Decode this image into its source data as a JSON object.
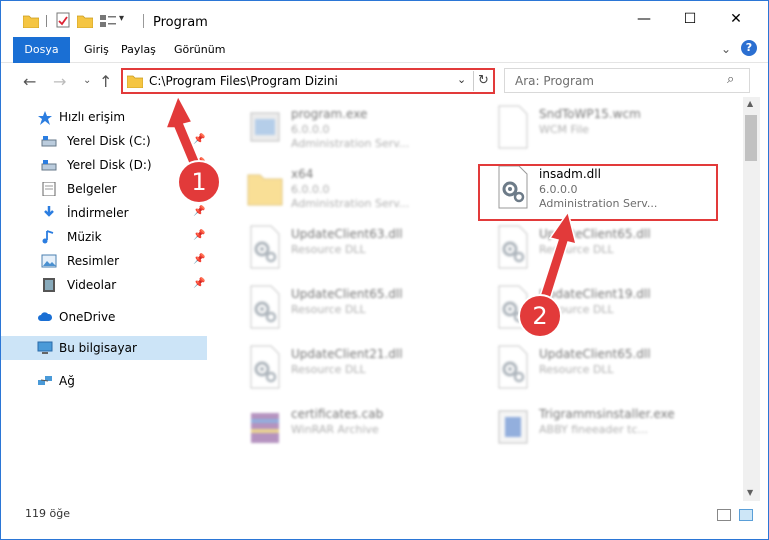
{
  "window": {
    "title": "Program",
    "controls": {
      "minimize": "—",
      "maximize": "☐",
      "close": "✕"
    }
  },
  "ribbon": {
    "tabs": [
      "Dosya",
      "Giriş",
      "Paylaş",
      "Görünüm"
    ],
    "expand": "⌄",
    "help": "?"
  },
  "nav": {
    "address": "C:\\Program Files\\Program Dizini",
    "search_placeholder": "Ara: Program",
    "back": "←",
    "forward": "→",
    "recent": "⌄",
    "up": "↑",
    "address_dropdown": "⌄",
    "refresh": "↻",
    "search_icon": "⌕"
  },
  "sidebar": {
    "items": [
      {
        "label": "Hızlı erişim",
        "icon": "star-icon",
        "pinned": false
      },
      {
        "label": "Yerel Disk (C:)",
        "icon": "drive-icon",
        "pinned": true
      },
      {
        "label": "Yerel Disk (D:)",
        "icon": "drive-icon",
        "pinned": true
      },
      {
        "label": "Belgeler",
        "icon": "document-icon",
        "pinned": true
      },
      {
        "label": "İndirmeler",
        "icon": "download-icon",
        "pinned": true
      },
      {
        "label": "Müzik",
        "icon": "music-icon",
        "pinned": true
      },
      {
        "label": "Resimler",
        "icon": "picture-icon",
        "pinned": true
      },
      {
        "label": "Videolar",
        "icon": "video-icon",
        "pinned": true
      },
      {
        "label": "OneDrive",
        "icon": "cloud-icon",
        "pinned": false
      },
      {
        "label": "Bu bilgisayar",
        "icon": "computer-icon",
        "pinned": false,
        "selected": true
      },
      {
        "label": "Ağ",
        "icon": "network-icon",
        "pinned": false
      }
    ],
    "pin_glyph": "📌"
  },
  "files": [
    {
      "name": "program.exe",
      "sub1": "6.0.0.0",
      "sub2": "Administration Serv...",
      "icon": "exe-icon",
      "blurred": true
    },
    {
      "name": "SndToWP15.wcm",
      "sub1": "WCM File",
      "sub2": "",
      "icon": "blank-file-icon",
      "blurred": true
    },
    {
      "name": "x64",
      "sub1": "6.0.0.0",
      "sub2": "Administration Serv...",
      "icon": "folder-icon",
      "blurred": true
    },
    {
      "name": "insadm.dll",
      "sub1": "6.0.0.0",
      "sub2": "Administration Serv...",
      "icon": "dll-gear-icon",
      "blurred": false
    },
    {
      "name": "UpdateClient63.dll",
      "sub1": "Resource DLL",
      "sub2": "",
      "icon": "dll-gear-icon",
      "blurred": true
    },
    {
      "name": "UpdateClient65.dll",
      "sub1": "Resource DLL",
      "sub2": "",
      "icon": "dll-gear-icon",
      "blurred": true
    },
    {
      "name": "UpdateClient65.dll",
      "sub1": "Resource DLL",
      "sub2": "",
      "icon": "dll-gear-icon",
      "blurred": true
    },
    {
      "name": "UpdateClient19.dll",
      "sub1": "Resource DLL",
      "sub2": "",
      "icon": "dll-gear-icon",
      "blurred": true
    },
    {
      "name": "UpdateClient21.dll",
      "sub1": "Resource DLL",
      "sub2": "",
      "icon": "dll-gear-icon",
      "blurred": true
    },
    {
      "name": "UpdateClient65.dll",
      "sub1": "Resource DLL",
      "sub2": "",
      "icon": "dll-gear-icon",
      "blurred": true
    },
    {
      "name": "certificates.cab",
      "sub1": "WinRAR Archive",
      "sub2": "",
      "icon": "archive-icon",
      "blurred": true
    },
    {
      "name": "Trigrammsinstaller.exe",
      "sub1": "ABBY fineeader tc...",
      "sub2": "",
      "icon": "installer-icon",
      "blurred": true
    }
  ],
  "status": {
    "count": "119 öğe"
  },
  "scrollbar": {
    "up": "▲",
    "down": "▼"
  },
  "callouts": [
    "1",
    "2"
  ],
  "colors": {
    "accent": "#1a6fd4",
    "highlight": "#e23a3a",
    "selected": "#cce4f7"
  }
}
